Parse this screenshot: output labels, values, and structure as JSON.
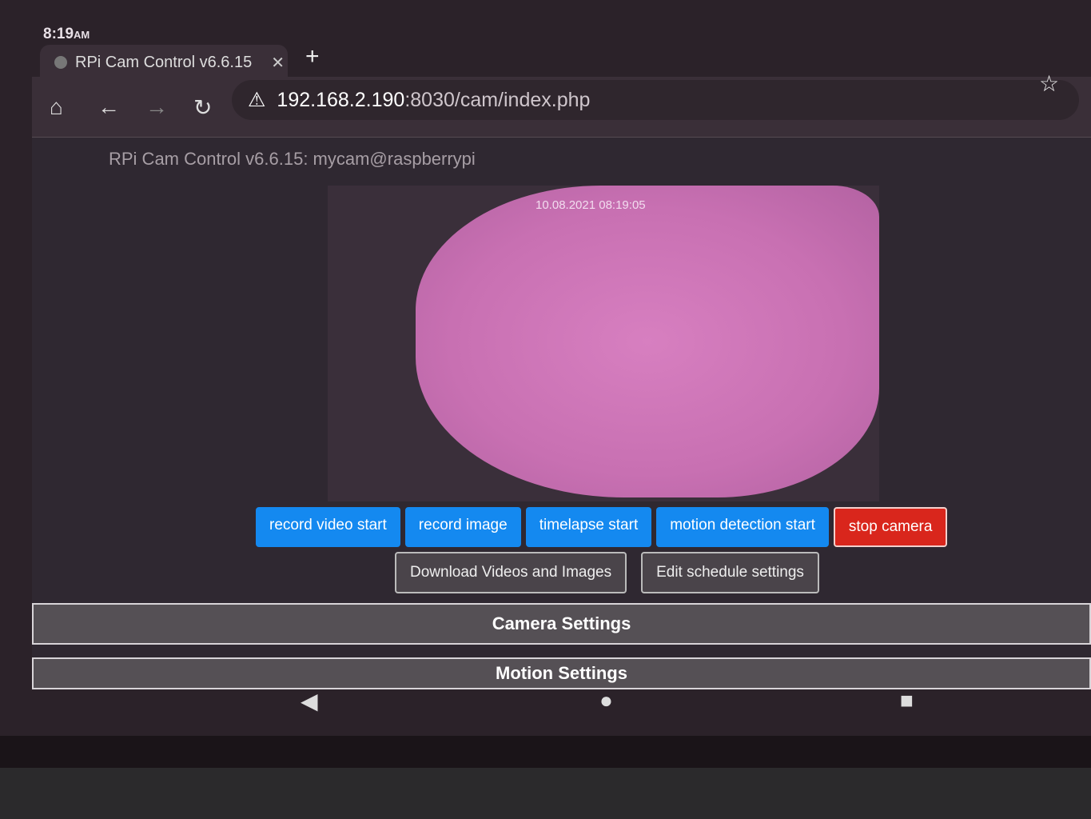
{
  "status_bar": {
    "time": "8:19",
    "ampm": "AM"
  },
  "browser": {
    "tab_title": "RPi Cam Control v6.6.15",
    "url_host": "192.168.2.190",
    "url_rest": ":8030/cam/index.php"
  },
  "page": {
    "title": "RPi Cam Control v6.6.15: mycam@raspberrypi",
    "camera_timestamp": "10.08.2021  08:19:05",
    "buttons": [
      "record video start",
      "record image",
      "timelapse start",
      "motion detection start",
      "stop camera"
    ],
    "secondary_buttons": [
      "Download Videos and Images",
      "Edit schedule settings"
    ],
    "panels": [
      "Camera Settings",
      "Motion Settings"
    ]
  },
  "colors": {
    "primary": "#1489f0",
    "danger": "#d9261c"
  }
}
